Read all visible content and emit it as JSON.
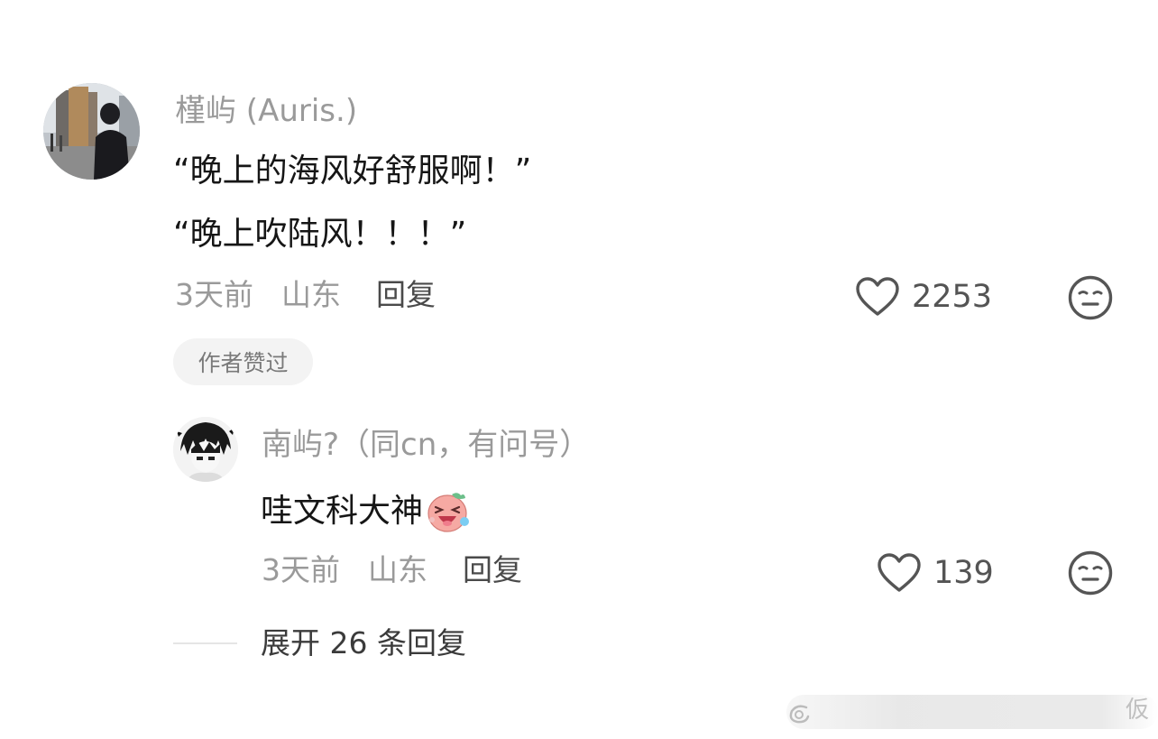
{
  "comment": {
    "username": "槿屿 (Auris.)",
    "lines": [
      "“晚上的海风好舒服啊！”",
      "“晚上吹陆风！！！”"
    ],
    "time": "3天前",
    "location": "山东",
    "reply_label": "回复",
    "like_count": "2253",
    "badge": "作者赞过"
  },
  "reply": {
    "username": "南屿?（同cn，有问号）",
    "text": "哇文科大神",
    "time": "3天前",
    "location": "山东",
    "reply_label": "回复",
    "like_count": "139"
  },
  "expand_label": "展开 26 条回复",
  "watermark_text": "仮",
  "icons": {
    "like": "heart-outline-icon",
    "dislike": "neutral-face-icon",
    "emoji": "pink-laughing-emoji-sticker"
  }
}
